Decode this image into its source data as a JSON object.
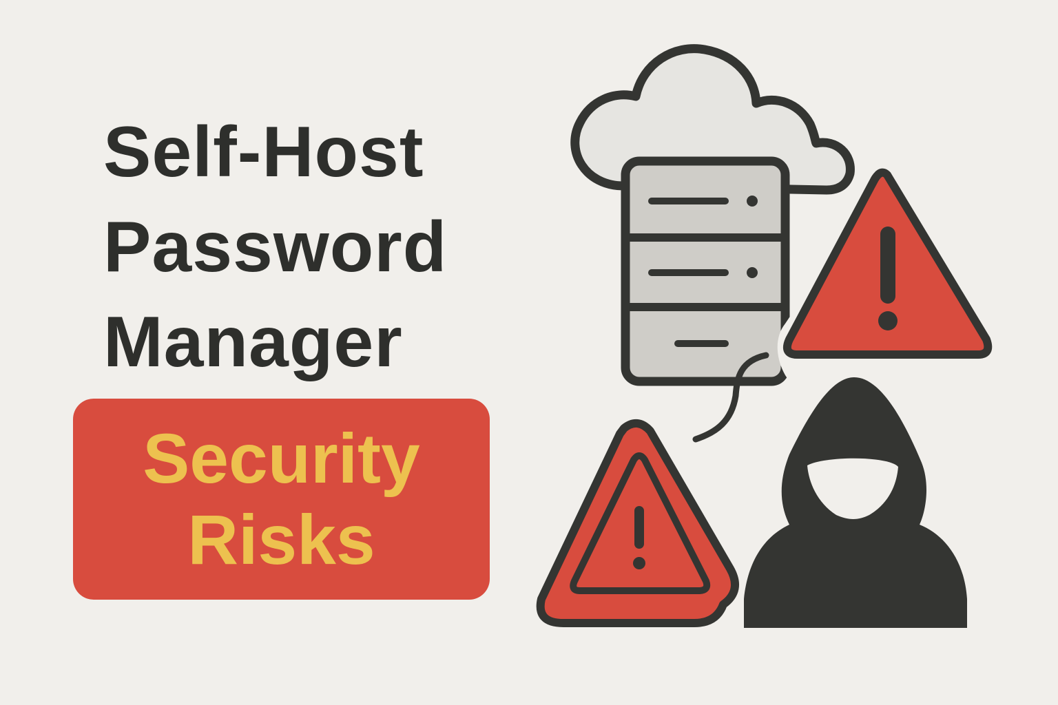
{
  "headline": {
    "line1": "Self-Host",
    "line2": "Password",
    "line3": "Manager"
  },
  "badge": {
    "line1": "Security",
    "line2": "Risks"
  },
  "colors": {
    "background": "#f1efeb",
    "text_dark": "#2e2f2c",
    "badge_red": "#d84c3e",
    "badge_text_yellow": "#edc14f",
    "warning_red": "#d84c3e",
    "server_gray": "#cfcdc8",
    "cloud_gray": "#e6e5e1"
  },
  "icons": [
    "cloud-icon",
    "server-icon",
    "warning-icon",
    "hacker-icon"
  ]
}
